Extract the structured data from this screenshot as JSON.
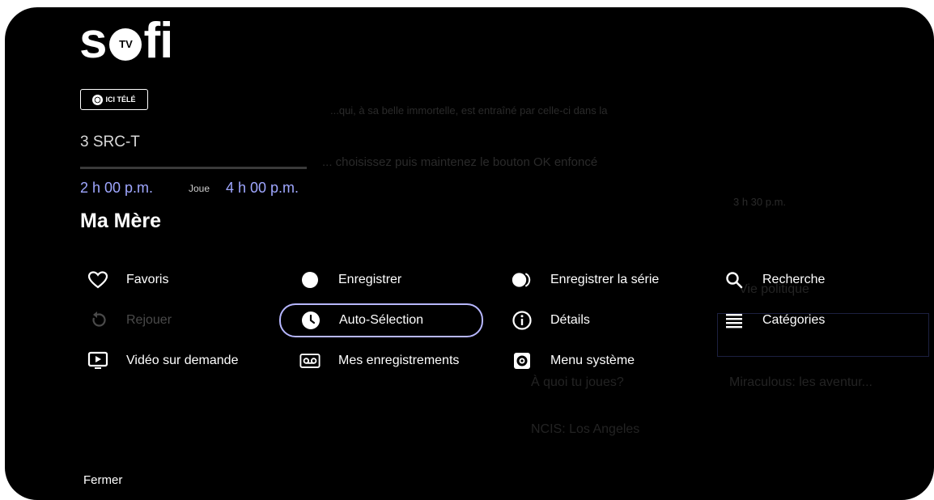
{
  "app": {
    "logo_text_left": "s",
    "logo_tv": "TV",
    "logo_text_right": "fi",
    "channel_badge": "ICI TÉLÉ"
  },
  "program": {
    "channel": "3 SRC-T",
    "progress": 0.0,
    "start_time": "2 h 00 p.m.",
    "state": "Joue",
    "end_time": "4 h 00 p.m.",
    "title": "Ma Mère"
  },
  "menu": {
    "favoris": "Favoris",
    "rejouer": "Rejouer",
    "vod": "Vidéo sur demande",
    "enregistrer": "Enregistrer",
    "auto_selection": "Auto-Sélection",
    "mes_enregistrements": "Mes enregistrements",
    "enregistrer_serie": "Enregistrer la série",
    "details": "Détails",
    "menu_systeme": "Menu système",
    "recherche": "Recherche",
    "categories": "Catégories"
  },
  "background": {
    "line1": "...qui, à sa belle immortelle, est entraîné par celle-ci dans la",
    "line2": "... choisissez puis maintenez le bouton OK enfoncé",
    "time": "3 h 30 p.m.",
    "vie_politique": "Vie politique",
    "a_quoi": "À quoi tu joues?",
    "miraculous": "Miraculous: les aventur...",
    "ncis": "NCIS: Los Angeles"
  },
  "footer": {
    "close": "Fermer"
  },
  "colors": {
    "accent_time": "#9fa7ff",
    "selection_border": "#b7b7ff",
    "background": "#000000"
  }
}
